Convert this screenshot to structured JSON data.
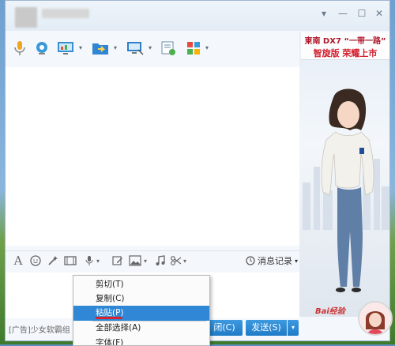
{
  "window": {
    "contact_name": "",
    "buttons": {
      "dropdown": "▾",
      "minimize": "—",
      "maximize": "☐",
      "close": "✕"
    }
  },
  "toolbar": {
    "icons": [
      "microphone-icon",
      "webcam-icon",
      "screen-share-icon",
      "folder-transfer-icon",
      "remote-desktop-icon",
      "note-icon",
      "apps-grid-icon"
    ]
  },
  "ad_banner": {
    "brand": "東南 DX7 “一带一路”",
    "slogan": "智旋版 荣耀上市"
  },
  "input_toolbar": {
    "font_glyph": "A",
    "message_record": "消息记录"
  },
  "context_menu": {
    "items": [
      {
        "label": "剪切(T)",
        "highlighted": false
      },
      {
        "label": "复制(C)",
        "highlighted": false
      },
      {
        "label": "粘贴(P)",
        "highlighted": true
      },
      {
        "label": "全部选择(A)",
        "highlighted": false
      },
      {
        "label": "字体(F)",
        "highlighted": false
      }
    ],
    "highlight_color": "#2f87d6"
  },
  "footer": {
    "ad_text": "[广告]少女软霸组",
    "close_label": "闭(C)",
    "send_label": "发送(S)",
    "send_dropdown": "▾"
  },
  "watermark": "Bai经验"
}
